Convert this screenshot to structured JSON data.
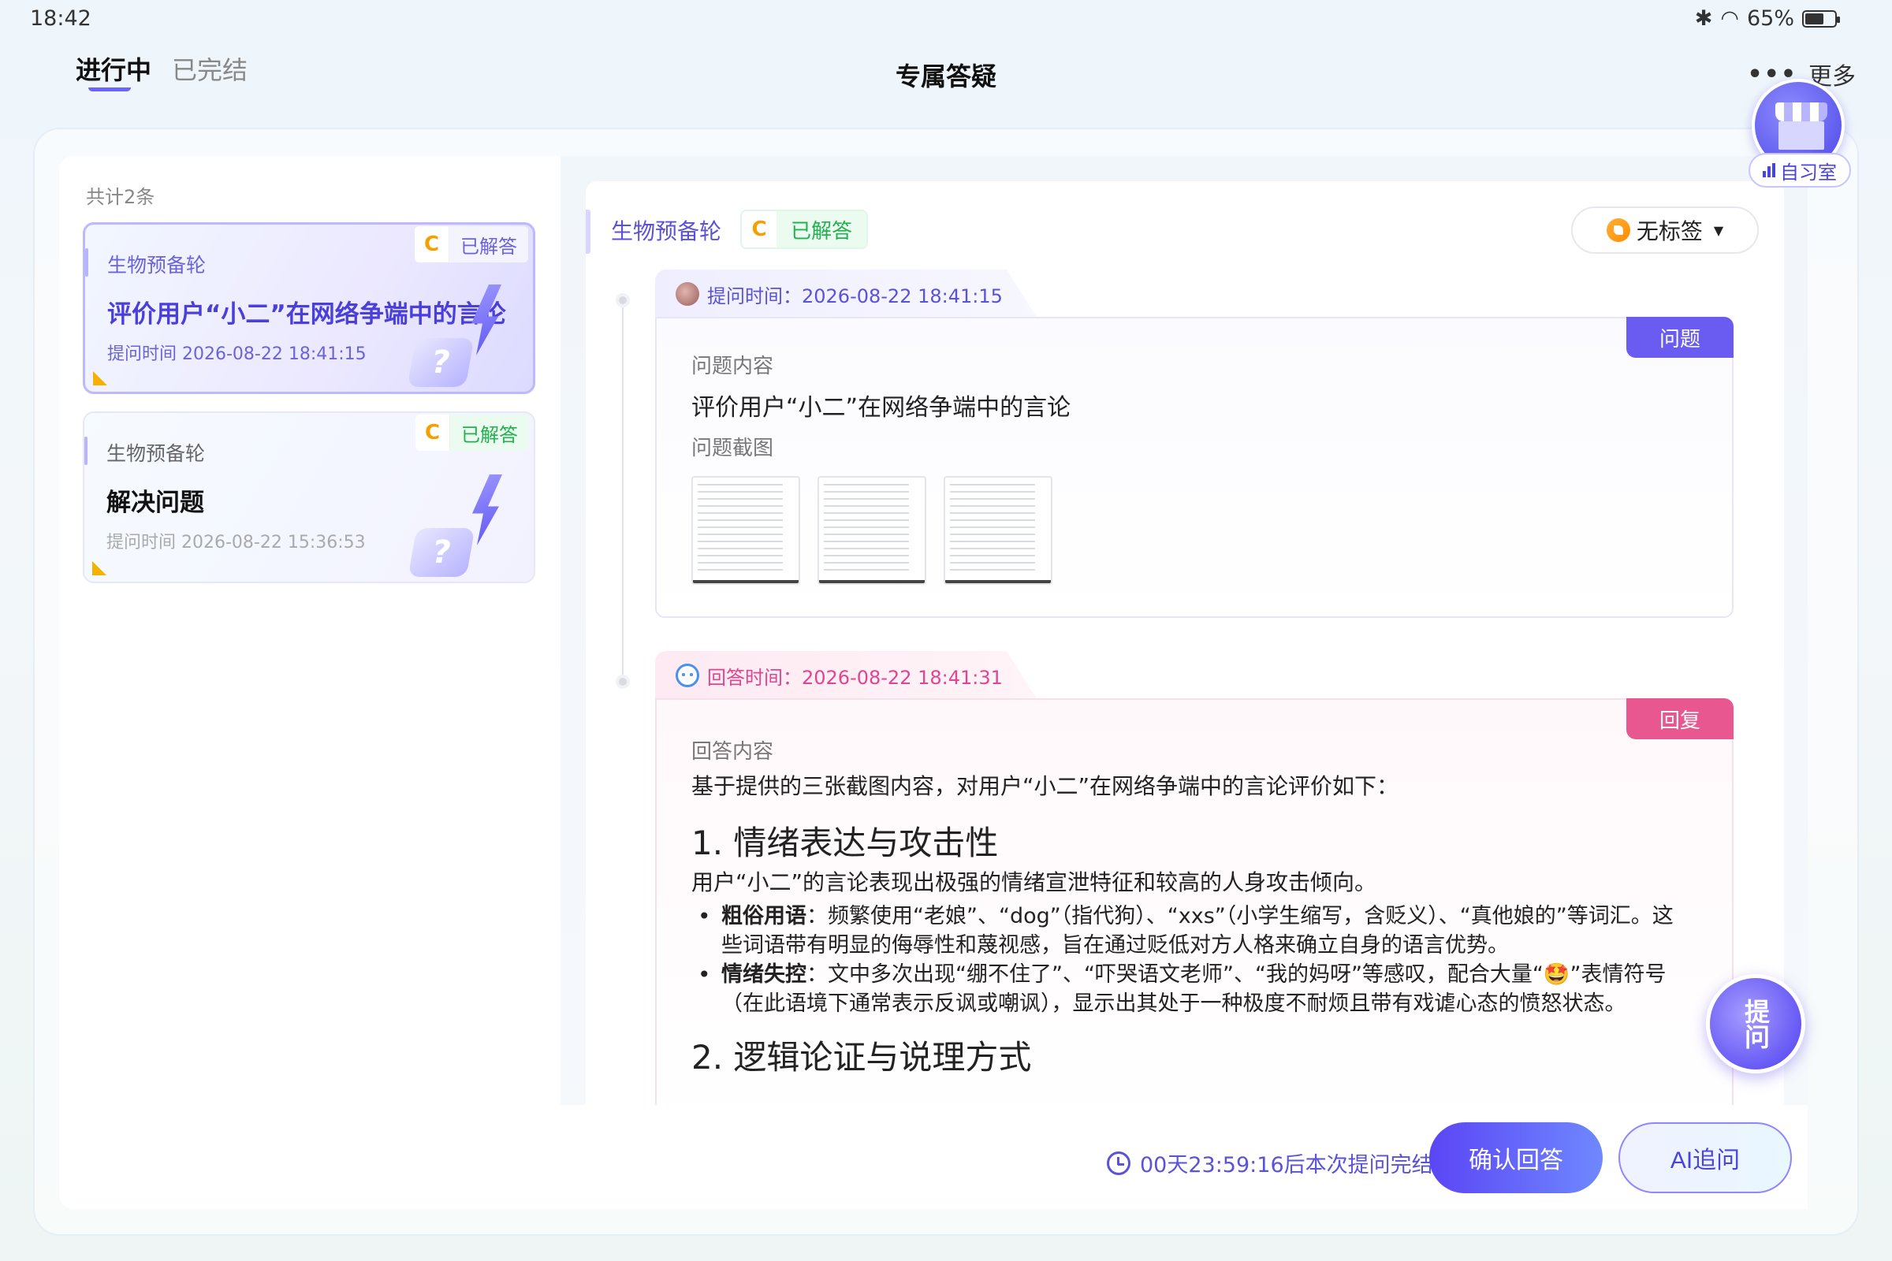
{
  "status_bar": {
    "time": "18:42",
    "battery": "65%",
    "battery_level": 0.65
  },
  "header": {
    "tabs": [
      {
        "label": "进行中",
        "active": true
      },
      {
        "label": "已完结",
        "active": false
      }
    ],
    "title": "专属答疑",
    "more_label": "更多"
  },
  "study_room": {
    "label": "自习室"
  },
  "sidebar": {
    "count_text": "共计2条",
    "items": [
      {
        "subject": "生物预备轮",
        "grade": "C",
        "state": "已解答",
        "title": "评价用户“小二”在网络争端中的言论",
        "time": "提问时间 2026-08-22 18:41:15",
        "selected": true
      },
      {
        "subject": "生物预备轮",
        "grade": "C",
        "state": "已解答",
        "title": "解决问题",
        "time": "提问时间 2026-08-22 15:36:53",
        "selected": false
      }
    ]
  },
  "detail": {
    "subject": "生物预备轮",
    "grade": "C",
    "state": "已解答",
    "tag_label": "无标签",
    "question": {
      "time_label": "提问时间：2026-08-22 18:41:15",
      "corner": "问题",
      "content_label": "问题内容",
      "content": "评价用户“小二”在网络争端中的言论",
      "screenshot_label": "问题截图",
      "screenshot_count": 3
    },
    "answer": {
      "time_label": "回答时间：2026-08-22 18:41:31",
      "corner": "回复",
      "content_label": "回答内容",
      "intro": "基于提供的三张截图内容，对用户“小二”在网络争端中的言论评价如下：",
      "section1_title": "1. 情绪表达与攻击性",
      "section1_intro": "用户“小二”的言论表现出极强的情绪宣泄特征和较高的人身攻击倾向。",
      "bullet1_title": "粗俗用语",
      "bullet1_text": "：频繁使用“老娘”、“dog”（指代狗）、“xxs”（小学生缩写，含贬义）、“真他娘的”等词汇。这些词语带有明显的侮辱性和蔑视感，旨在通过贬低对方人格来确立自身的语言优势。",
      "bullet2_title": "情绪失控",
      "bullet2_text": "：文中多次出现“绷不住了”、“吓哭语文老师”、“我的妈呀”等感叹，配合大量“🤩”表情符号（在此语境下通常表示反讽或嘲讽），显示出其处于一种极度不耐烦且带有戏谑心态的愤怒状态。",
      "section2_title": "2. 逻辑论证与说理方式"
    }
  },
  "fab": {
    "label": "提问"
  },
  "footer": {
    "countdown": "00天23:59:16后本次提问完结",
    "confirm_label": "确认回答",
    "ai_label": "AI追问"
  },
  "colors": {
    "accent": "#5b45f5",
    "question": "#6a5cf0",
    "reply": "#e8578f",
    "success": "#23b04f",
    "grade": "#f5a000"
  }
}
